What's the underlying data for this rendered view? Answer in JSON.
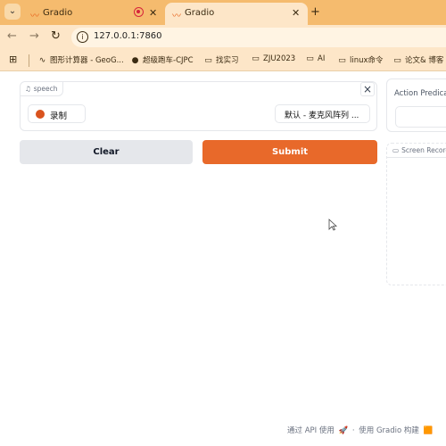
{
  "browser": {
    "tabs": [
      {
        "title": "Gradio",
        "recording": true
      },
      {
        "title": "Gradio",
        "active": true
      }
    ],
    "url": "127.0.0.1:7860",
    "bookmarks": [
      {
        "label": "图形计算器 - GeoG...",
        "icon": "geogebra-icon"
      },
      {
        "label": "超级跑车-CJPC",
        "icon": "globe-icon"
      },
      {
        "label": "找实习",
        "icon": "folder-icon"
      },
      {
        "label": "ZJU2023",
        "icon": "folder-icon"
      },
      {
        "label": "AI",
        "icon": "folder-icon"
      },
      {
        "label": "linux命令",
        "icon": "folder-icon"
      },
      {
        "label": "论文& 博客",
        "icon": "folder-icon"
      }
    ]
  },
  "audio": {
    "label": "speech",
    "record_label": "录制",
    "mic_device": "默认 - 麦克风阵列 ..."
  },
  "buttons": {
    "clear": "Clear",
    "submit": "Submit"
  },
  "prediction": {
    "label": "Action Predicat"
  },
  "screen_recording": {
    "label": "Screen Record"
  },
  "footer": {
    "api": "通过 API 使用",
    "built_with": "使用 Gradio 构建"
  },
  "colors": {
    "tab_bar": "#f5bb6e",
    "toolbar": "#fde6c8",
    "submit": "#e8692a",
    "record_dot": "#d9531e"
  }
}
